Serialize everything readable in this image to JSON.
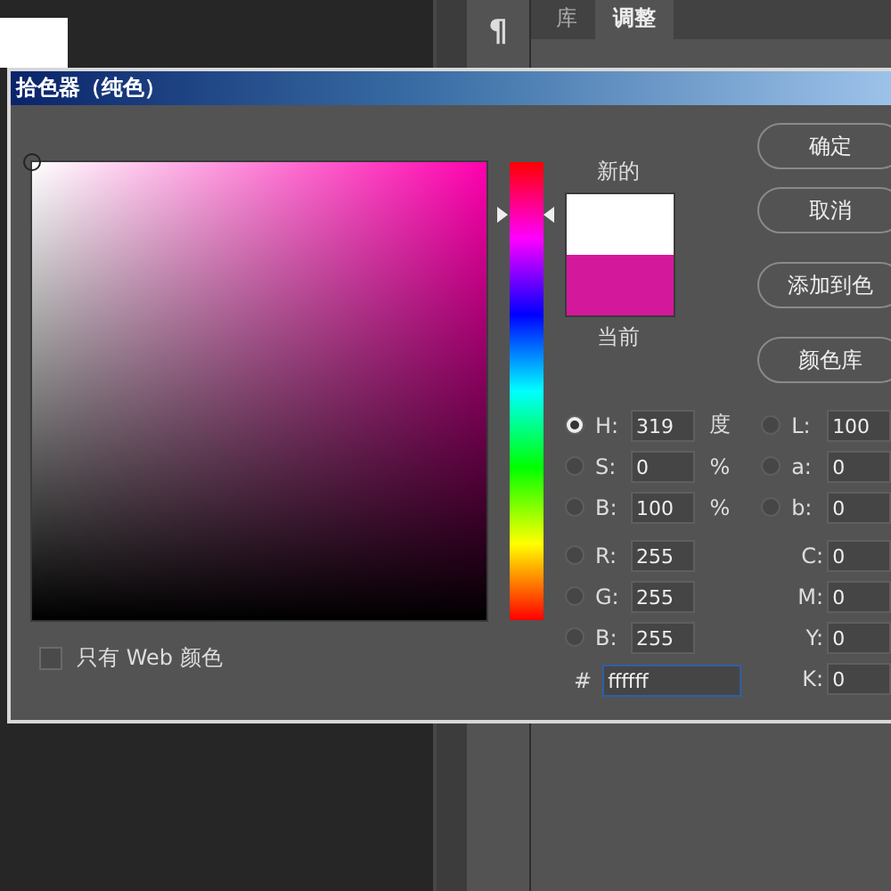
{
  "background": {
    "panel_icon": "¶",
    "tabs": [
      {
        "label": "库",
        "selected": false
      },
      {
        "label": "调整",
        "selected": true
      }
    ]
  },
  "dialog": {
    "title": "拾色器（纯色）",
    "hue": {
      "level": 0.886
    },
    "swatches": [
      {
        "label": "新的",
        "color": "#ffffff"
      },
      {
        "label": "当前",
        "color": "#d4189b"
      }
    ],
    "buttons": [
      "确定",
      "取消",
      "添加到色",
      "颜色库"
    ],
    "left_fields": [
      {
        "kind": "radio",
        "label": "H:",
        "value": "319",
        "unit": "度",
        "selected": true
      },
      {
        "kind": "radio",
        "label": "S:",
        "value": "0",
        "unit": "%",
        "selected": false
      },
      {
        "kind": "radio",
        "label": "B:",
        "value": "100",
        "unit": "%",
        "selected": false
      },
      {
        "kind": "radio",
        "label": "R:",
        "value": "255",
        "selected": false
      },
      {
        "kind": "radio",
        "label": "G:",
        "value": "255",
        "selected": false
      },
      {
        "kind": "radio",
        "label": "B:",
        "value": "255",
        "selected": false
      }
    ],
    "right_fields": [
      {
        "kind": "radio",
        "label": "L:",
        "value": "100",
        "selected": false
      },
      {
        "kind": "radio",
        "label": "a:",
        "value": "0",
        "selected": false
      },
      {
        "kind": "radio",
        "label": "b:",
        "value": "0",
        "selected": false
      },
      {
        "kind": "plain",
        "label": "C:",
        "value": "0"
      },
      {
        "kind": "plain",
        "label": "M:",
        "value": "0"
      },
      {
        "kind": "plain",
        "label": "Y:",
        "value": "0"
      },
      {
        "kind": "plain",
        "label": "K:",
        "value": "0"
      }
    ],
    "hex": {
      "label": "#",
      "value": "ffffff",
      "focused": true
    },
    "web_only": {
      "label": "只有 Web 颜色",
      "checked": false
    }
  }
}
